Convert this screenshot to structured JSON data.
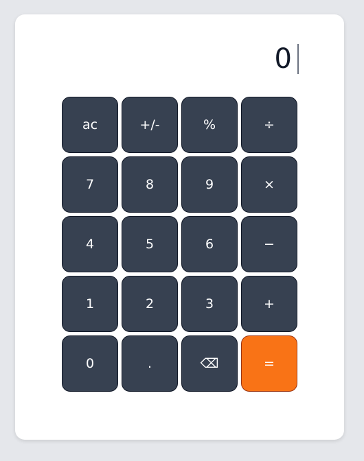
{
  "display": {
    "value": "0"
  },
  "keys": [
    {
      "label": "ac",
      "name": "ac-button"
    },
    {
      "label": "+/-",
      "name": "plus-minus-button"
    },
    {
      "label": "%",
      "name": "percent-button"
    },
    {
      "label": "÷",
      "name": "divide-button"
    },
    {
      "label": "7",
      "name": "digit-7-button"
    },
    {
      "label": "8",
      "name": "digit-8-button"
    },
    {
      "label": "9",
      "name": "digit-9-button"
    },
    {
      "label": "×",
      "name": "multiply-button"
    },
    {
      "label": "4",
      "name": "digit-4-button"
    },
    {
      "label": "5",
      "name": "digit-5-button"
    },
    {
      "label": "6",
      "name": "digit-6-button"
    },
    {
      "label": "−",
      "name": "minus-button"
    },
    {
      "label": "1",
      "name": "digit-1-button"
    },
    {
      "label": "2",
      "name": "digit-2-button"
    },
    {
      "label": "3",
      "name": "digit-3-button"
    },
    {
      "label": "+",
      "name": "plus-button"
    },
    {
      "label": "0",
      "name": "digit-0-button"
    },
    {
      "label": ".",
      "name": "decimal-button"
    },
    {
      "label": "⌫",
      "name": "backspace-button"
    },
    {
      "label": "=",
      "name": "equals-button"
    }
  ],
  "colors": {
    "background": "#e5e7eb",
    "key": "#374151",
    "equals": "#f97316",
    "display_text": "#111827"
  }
}
